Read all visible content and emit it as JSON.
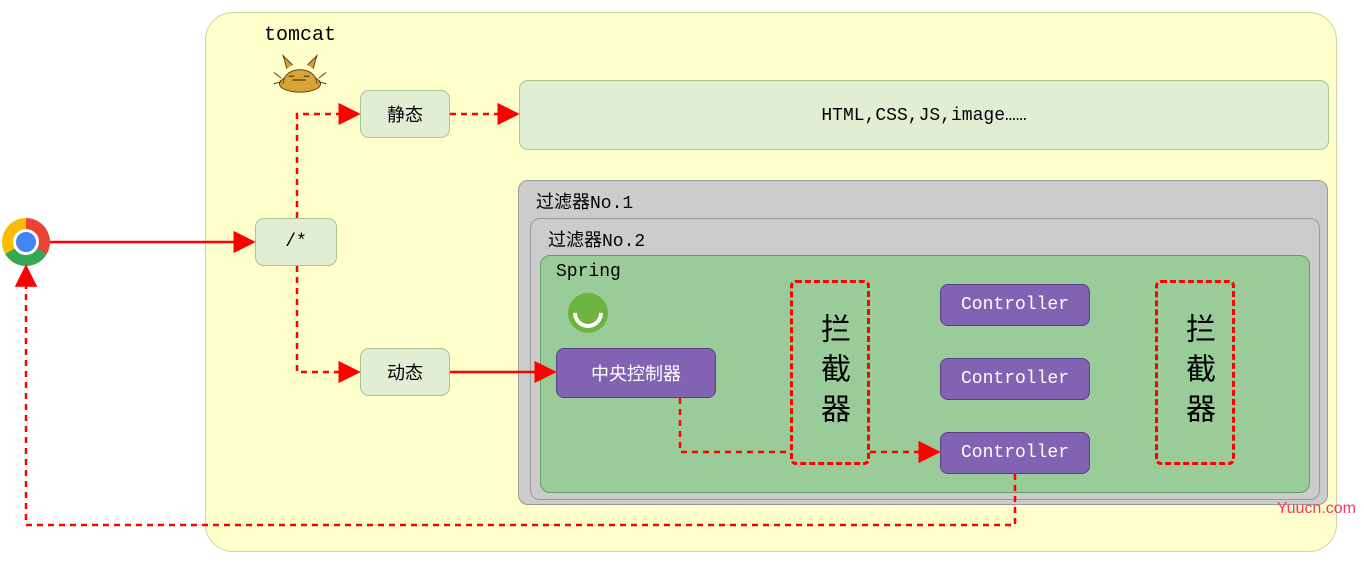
{
  "tomcat_label": "tomcat",
  "pattern_label": "/*",
  "static_label": "静态",
  "dynamic_label": "动态",
  "static_result": "HTML,CSS,JS,image……",
  "filter1_label": "过滤器No.1",
  "filter2_label": "过滤器No.2",
  "spring_label": "Spring",
  "central_controller": "中央控制器",
  "interceptor_label": "拦截器",
  "controller_label": "Controller",
  "watermark": "Yuucn.com"
}
